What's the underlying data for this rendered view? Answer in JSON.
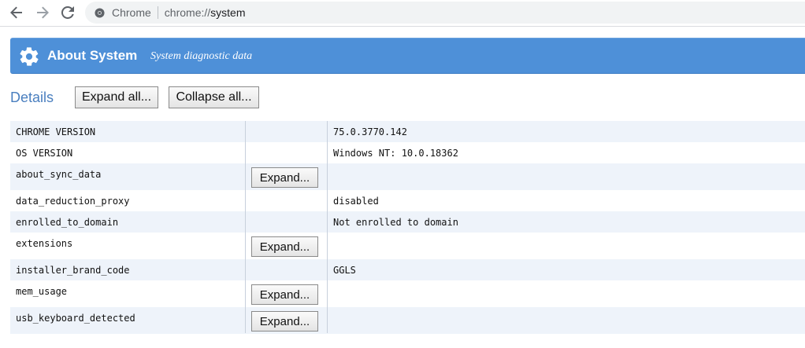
{
  "browser": {
    "site_name": "Chrome",
    "url": "chrome://",
    "url_path": "system"
  },
  "banner": {
    "title": "About System",
    "subtitle": "System diagnostic data"
  },
  "details": {
    "label": "Details",
    "expand_all": "Expand all...",
    "collapse_all": "Collapse all..."
  },
  "rows": [
    {
      "key": "CHROME VERSION",
      "value": "75.0.3770.142",
      "button": ""
    },
    {
      "key": "OS VERSION",
      "value": "Windows NT: 10.0.18362",
      "button": ""
    },
    {
      "key": "about_sync_data",
      "value": "",
      "button": "Expand..."
    },
    {
      "key": "data_reduction_proxy",
      "value": "disabled",
      "button": ""
    },
    {
      "key": "enrolled_to_domain",
      "value": "Not enrolled to domain",
      "button": ""
    },
    {
      "key": "extensions",
      "value": "",
      "button": "Expand..."
    },
    {
      "key": "installer_brand_code",
      "value": "GGLS",
      "button": ""
    },
    {
      "key": "mem_usage",
      "value": "",
      "button": "Expand..."
    },
    {
      "key": "usb_keyboard_detected",
      "value": "",
      "button": "Expand..."
    }
  ],
  "colors": {
    "banner": "#4e90d8",
    "details_label": "#4a7fbf",
    "row_stripe": "#eef3fa"
  },
  "icons": {
    "back": "arrow-left-icon",
    "forward": "arrow-right-icon",
    "reload": "reload-icon",
    "site": "chrome-icon",
    "banner": "gear-icon"
  }
}
